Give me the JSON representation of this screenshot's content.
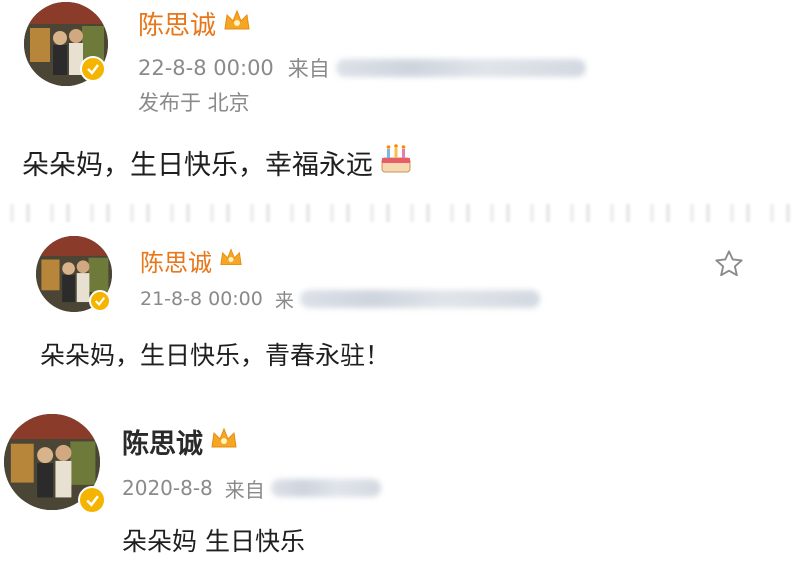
{
  "posts": [
    {
      "author": "陈思诚",
      "date": "22-8-8 00:00",
      "source_prefix": "来自",
      "location": "发布于 北京",
      "text": "朵朵妈，生日快乐，幸福永远"
    },
    {
      "author": "陈思诚",
      "date": "21-8-8 00:00",
      "source_prefix": "来",
      "text": "朵朵妈，生日快乐，青春永驻！"
    },
    {
      "author": "陈思诚",
      "date": "2020-8-8",
      "source_prefix": "来自",
      "text": "朵朵妈 生日快乐"
    }
  ],
  "colors": {
    "author_orange": "#e8761a",
    "meta_gray": "#8a8a8a",
    "verified_gold": "#f5b400"
  },
  "icons": [
    "crown-icon",
    "verified-icon",
    "cake-emoji-icon",
    "star-icon"
  ]
}
